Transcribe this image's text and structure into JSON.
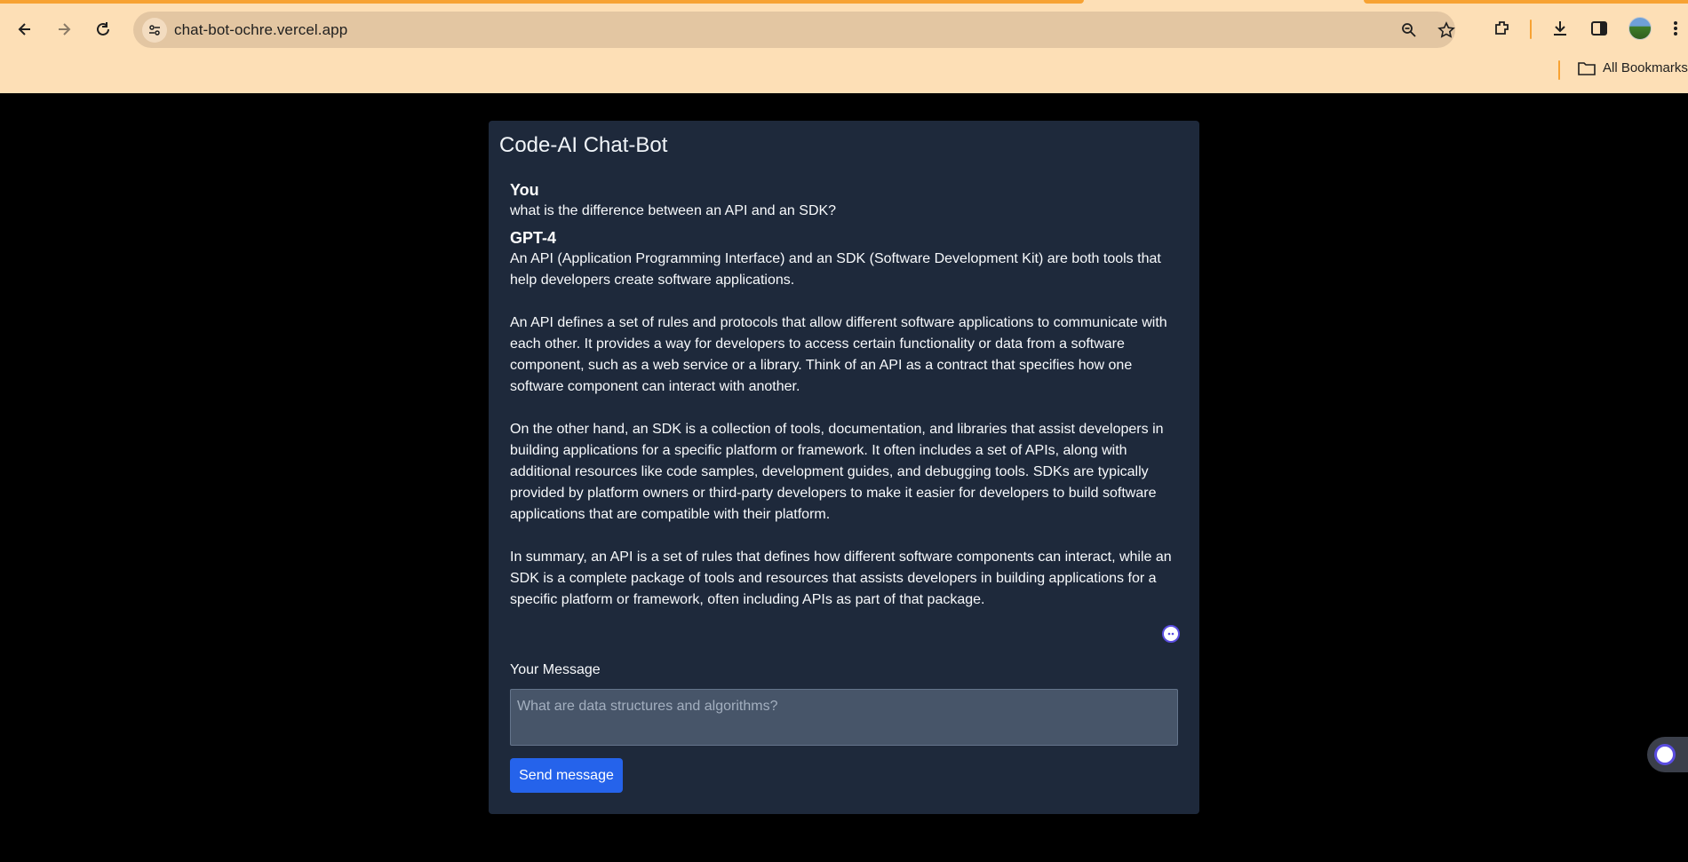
{
  "browser": {
    "url": "chat-bot-ochre.vercel.app",
    "bookmarks_label": "All Bookmarks",
    "accent_color": "#f7a233"
  },
  "app": {
    "title": "Code-AI Chat-Bot",
    "messages": [
      {
        "sender": "You",
        "text": "what is the difference between an API and an SDK?"
      },
      {
        "sender": "GPT-4",
        "text": "An API (Application Programming Interface) and an SDK (Software Development Kit) are both tools that help developers create software applications.\n\nAn API defines a set of rules and protocols that allow different software applications to communicate with each other. It provides a way for developers to access certain functionality or data from a software component, such as a web service or a library. Think of an API as a contract that specifies how one software component can interact with another.\n\nOn the other hand, an SDK is a collection of tools, documentation, and libraries that assist developers in building applications for a specific platform or framework. It often includes a set of APIs, along with additional resources like code samples, development guides, and debugging tools. SDKs are typically provided by platform owners or third-party developers to make it easier for developers to build software applications that are compatible with their platform.\n\nIn summary, an API is a set of rules that defines how different software components can interact, while an SDK is a complete package of tools and resources that assists developers in building applications for a specific platform or framework, often including APIs as part of that package."
      }
    ],
    "input_label": "Your Message",
    "input_placeholder": "What are data structures and algorithms?",
    "input_value": "",
    "send_label": "Send message",
    "colors": {
      "card_bg": "#1e293b",
      "input_bg": "#475569",
      "button_bg": "#2563eb"
    }
  }
}
